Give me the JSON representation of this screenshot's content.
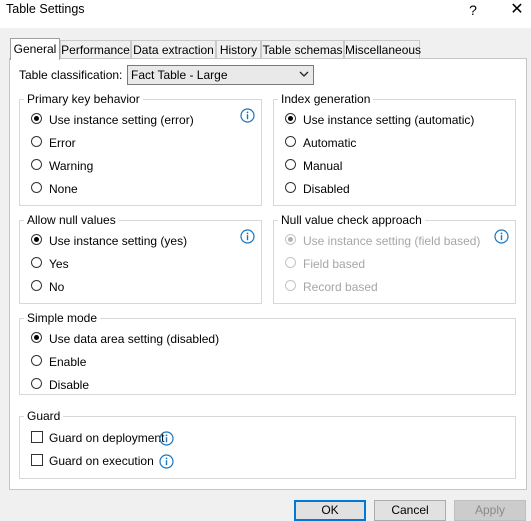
{
  "window": {
    "title": "Table Settings",
    "help": "?",
    "close": "✕"
  },
  "tabs": [
    {
      "label": "General",
      "active": true
    },
    {
      "label": "Performance"
    },
    {
      "label": "Data extraction"
    },
    {
      "label": "History"
    },
    {
      "label": "Table schemas"
    },
    {
      "label": "Miscellaneous"
    }
  ],
  "classification": {
    "label": "Table classification:",
    "value": "Fact Table - Large"
  },
  "primary_key": {
    "legend": "Primary key behavior",
    "options": [
      "Use instance setting (error)",
      "Error",
      "Warning",
      "None"
    ],
    "selected": 0
  },
  "index_generation": {
    "legend": "Index generation",
    "options": [
      "Use instance setting (automatic)",
      "Automatic",
      "Manual",
      "Disabled"
    ],
    "selected": 0
  },
  "allow_null": {
    "legend": "Allow null values",
    "options": [
      "Use instance setting (yes)",
      "Yes",
      "No"
    ],
    "selected": 0
  },
  "null_check": {
    "legend": "Null value check approach",
    "options": [
      "Use instance setting (field based)",
      "Field based",
      "Record based"
    ],
    "selected": 0,
    "disabled": true
  },
  "simple_mode": {
    "legend": "Simple mode",
    "options": [
      "Use data area setting (disabled)",
      "Enable",
      "Disable"
    ],
    "selected": 0
  },
  "guard": {
    "legend": "Guard",
    "items": [
      "Guard on deployment",
      "Guard on execution"
    ]
  },
  "buttons": {
    "ok": "OK",
    "cancel": "Cancel",
    "apply": "Apply"
  },
  "colors": {
    "accent": "#0078d7",
    "info_icon": "#1b75bb"
  }
}
